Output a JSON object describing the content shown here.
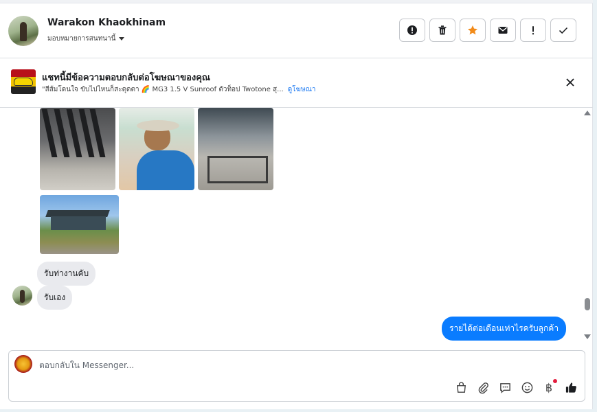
{
  "header": {
    "contact_name": "Warakon Khaokhinam",
    "assign_label": "มอบหมายการสนทนานี้"
  },
  "actions": [
    "spam-alert",
    "delete",
    "star",
    "mail",
    "exclamation",
    "done"
  ],
  "ad": {
    "title": "แชทนี้มีข้อความตอบกลับต่อโฆษณาของคุณ",
    "snippet": "\"สีส้มโดนใจ ขับไปไหนก็สะดุดตา 🌈 MG3 1.5 V Sunroof ตัวท็อป Twotone สุ...",
    "link": "ดูโฆษณา"
  },
  "messages": {
    "incoming": [
      "รับท่างานคับ",
      "รับเอง"
    ],
    "outgoing": [
      "รายได้ต่อเดือนเท่าไรครับลูกค้า"
    ]
  },
  "composer": {
    "placeholder": "ตอบกลับใน Messenger...",
    "baht_symbol": "฿"
  },
  "colors": {
    "accent": "#0a7cff",
    "star": "#f28b1a",
    "badge": "#e41e3f"
  }
}
